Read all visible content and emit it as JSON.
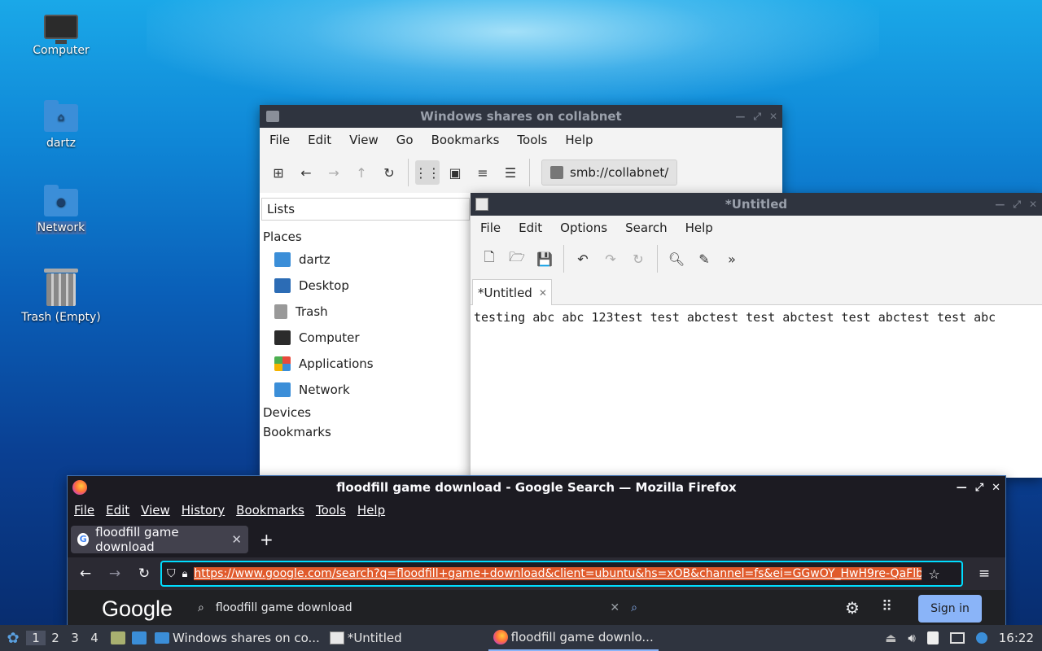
{
  "desktop": {
    "icons": [
      {
        "label": "Computer",
        "icon": "computer-icon"
      },
      {
        "label": "dartz",
        "icon": "home-folder-icon"
      },
      {
        "label": "Network",
        "icon": "network-folder-icon"
      },
      {
        "label": "Trash (Empty)",
        "icon": "trash-icon"
      }
    ]
  },
  "file_manager": {
    "title": "Windows shares on collabnet",
    "menu": [
      "File",
      "Edit",
      "View",
      "Go",
      "Bookmarks",
      "Tools",
      "Help"
    ],
    "path": "smb://collabnet/",
    "side_header": "Lists",
    "sections": {
      "places": "Places",
      "devices": "Devices",
      "bookmarks": "Bookmarks"
    },
    "places": [
      "dartz",
      "Desktop",
      "Trash",
      "Computer",
      "Applications",
      "Network"
    ]
  },
  "text_editor": {
    "title": "*Untitled",
    "menu": [
      "File",
      "Edit",
      "Options",
      "Search",
      "Help"
    ],
    "tab_label": "*Untitled",
    "content": "testing abc abc 123test test abctest test abctest test abctest test abc"
  },
  "browser": {
    "title": "floodfill game download - Google Search — Mozilla Firefox",
    "menu": [
      "File",
      "Edit",
      "View",
      "History",
      "Bookmarks",
      "Tools",
      "Help"
    ],
    "tab_label": "floodfill game download",
    "url": "https://www.google.com/search?q=floodfill+game+download&client=ubuntu&hs=xOB&channel=fs&ei=GGwOY_HwH9re-QaFlb",
    "logo": "Google",
    "search_query": "floodfill game download",
    "signin_label": "Sign in"
  },
  "taskbar": {
    "workspaces": [
      "1",
      "2",
      "3",
      "4"
    ],
    "tasks": [
      {
        "label": "Windows shares on co...",
        "active": false
      },
      {
        "label": "*Untitled",
        "active": false
      },
      {
        "label": "floodfill game downlo...",
        "active": true
      }
    ],
    "clock": "16:22"
  },
  "colors": {
    "accent": "#3d6fb0",
    "url_highlight": "#e05a2b",
    "titlebar": "#2f343f",
    "signin": "#8ab4f8"
  }
}
